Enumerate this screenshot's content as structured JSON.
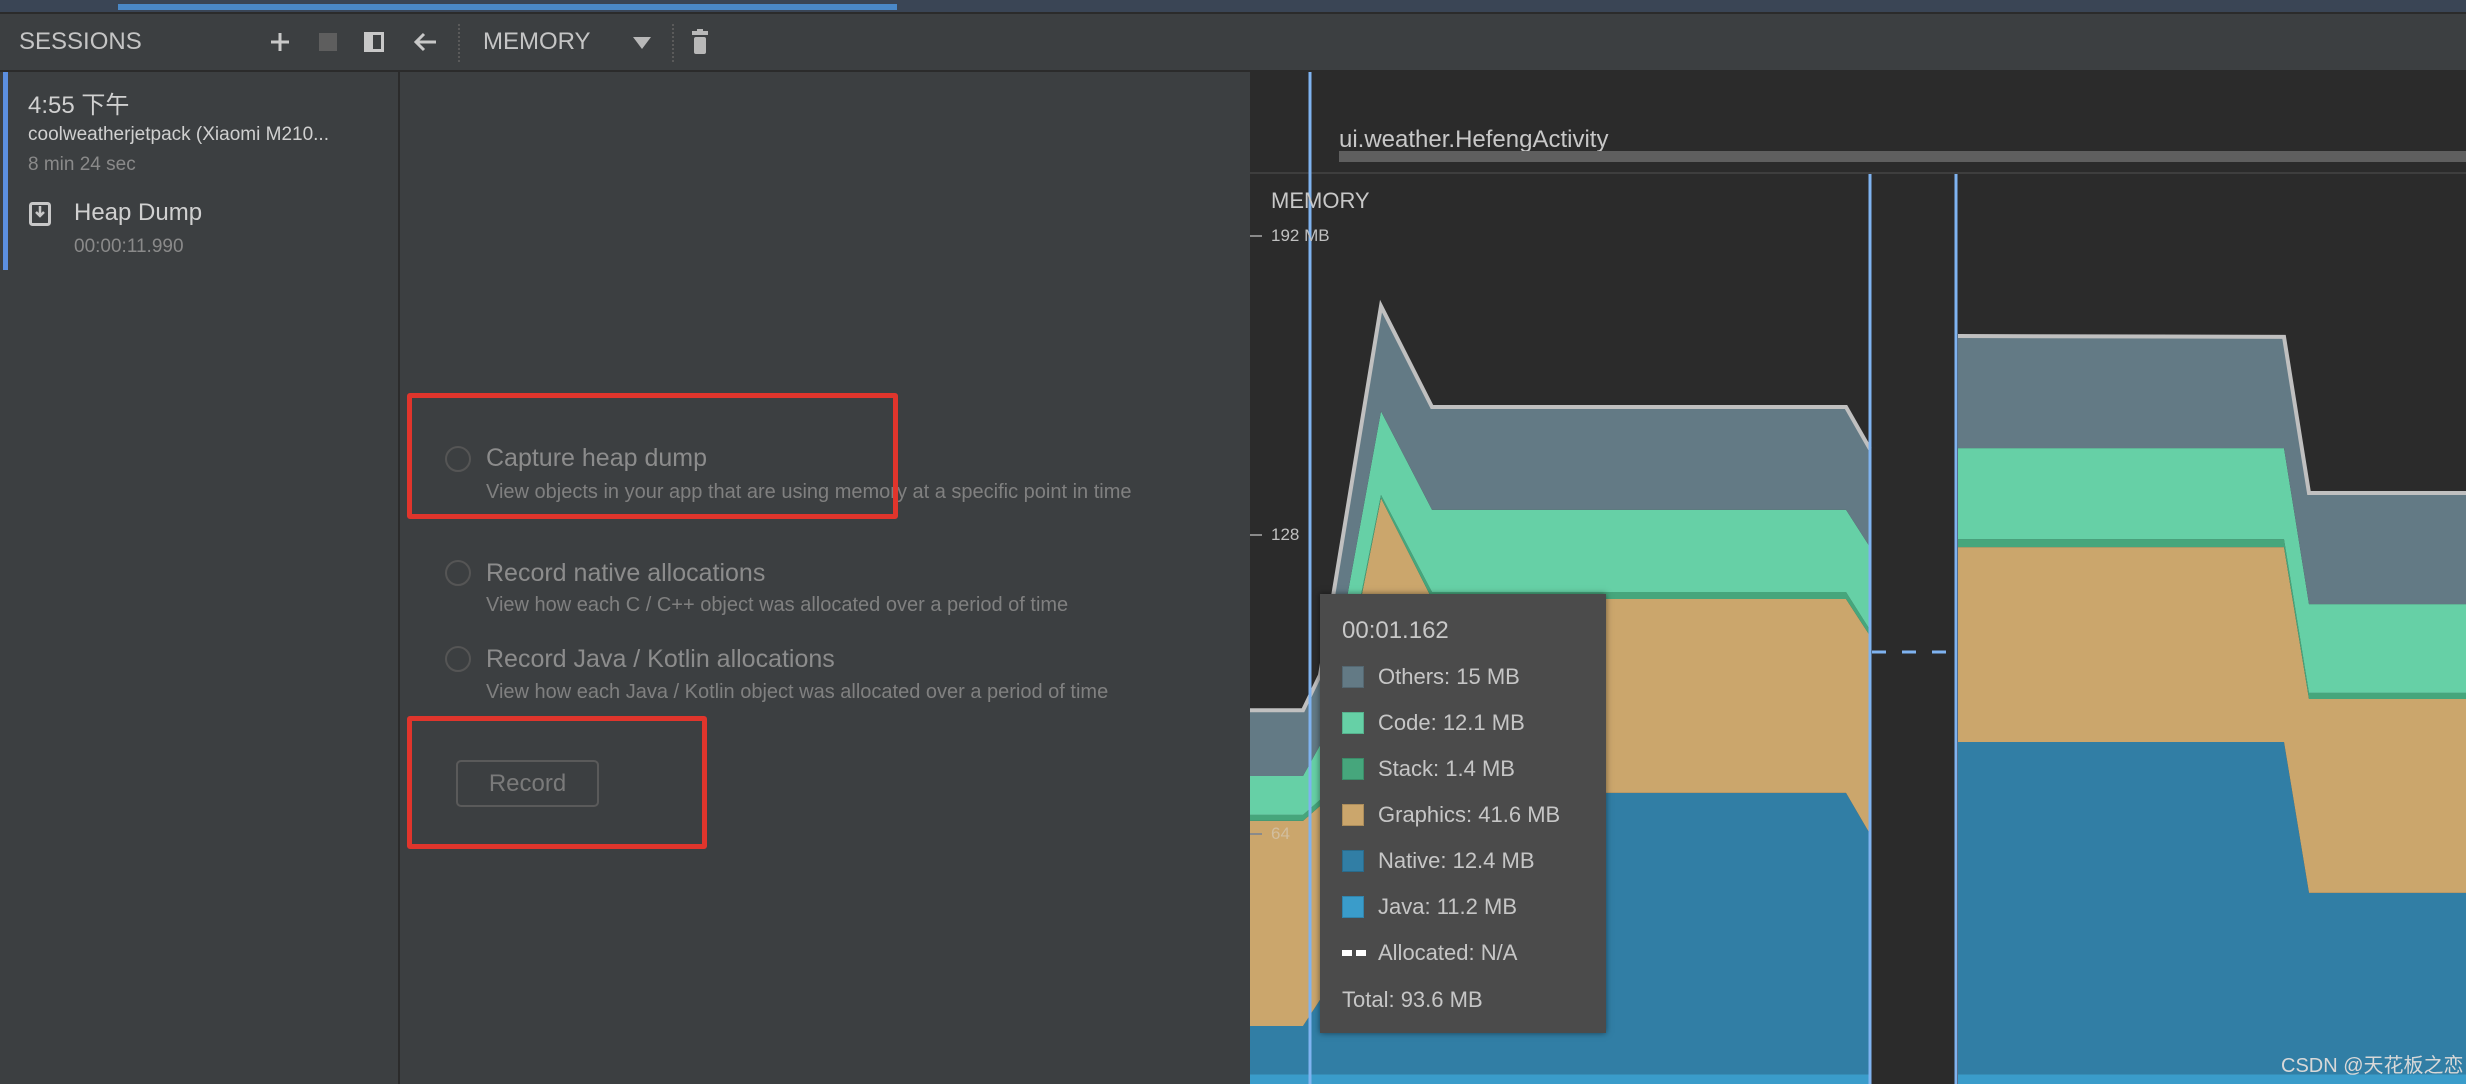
{
  "toolbar": {
    "sessions_title": "SESSIONS",
    "add_icon": "plus-icon",
    "stop_icon": "stop-icon",
    "layout_icon": "panel-toggle-icon",
    "back_icon": "arrow-left-icon",
    "profiler_select": "MEMORY",
    "delete_icon": "trash-icon"
  },
  "session": {
    "time": "4:55 下午",
    "app": "coolweatherjetpack (Xiaomi M210...",
    "duration": "8 min 24 sec",
    "artifact": {
      "icon": "heap-dump-icon",
      "title": "Heap Dump",
      "timestamp": "00:00:11.990"
    }
  },
  "options": [
    {
      "title": "Capture heap dump",
      "desc": "View objects in your app that are using memory at a specific point in time",
      "selected": false
    },
    {
      "title": "Record native allocations",
      "desc": "View how each C / C++ object was allocated over a period of time",
      "selected": false
    },
    {
      "title": "Record Java / Kotlin allocations",
      "desc": "View how each Java / Kotlin object was allocated over a period of time",
      "selected": false
    }
  ],
  "record_label": "Record",
  "annotation_color": "#e0352c",
  "activity_label": "ui.weather.HefengActivity",
  "chart_data": {
    "type": "area",
    "stacked": true,
    "title": "MEMORY",
    "y_ticks": [
      "192 MB",
      "128",
      "64"
    ],
    "y_tick_values": [
      192,
      128,
      64
    ],
    "ylim": [
      0,
      192
    ],
    "segments": [
      {
        "samples": 7,
        "series": [
          {
            "name": "Java",
            "color": "#3a9cca",
            "values": [
              12.6,
              12.6,
              12.6,
              12.6,
              12.6,
              12.6,
              12.6
            ]
          },
          {
            "name": "Native",
            "color": "#317ea5",
            "values": [
              10.3,
              10.3,
              15.9,
              60.2,
              60.2,
              60.2,
              51.4
            ]
          },
          {
            "name": "Graphics",
            "color": "#cba66c",
            "values": [
              43.9,
              43.9,
              41.5,
              63.1,
              41.5,
              41.5,
              42.4
            ]
          },
          {
            "name": "Stack",
            "color": "#46a67c",
            "values": [
              1.3,
              1.3,
              1.3,
              0.7,
              1.5,
              1.5,
              1.3
            ]
          },
          {
            "name": "Code",
            "color": "#66d0a6",
            "values": [
              8.3,
              8.3,
              11.7,
              17.9,
              17.6,
              17.6,
              17.7
            ]
          },
          {
            "name": "Others",
            "color": "#637a85",
            "values": [
              14.1,
              14.1,
              15.0,
              22.5,
              22.0,
              22.0,
              21.0
            ]
          }
        ]
      },
      {
        "samples": 4,
        "series": [
          {
            "name": "Java",
            "color": "#3a9cca",
            "values": [
              12.6,
              12.6,
              12.6,
              12.6
            ]
          },
          {
            "name": "Native",
            "color": "#317ea5",
            "values": [
              71.1,
              71.1,
              38.8,
              38.8
            ]
          },
          {
            "name": "Graphics",
            "color": "#cba66c",
            "values": [
              41.7,
              41.7,
              41.5,
              41.5
            ]
          },
          {
            "name": "Stack",
            "color": "#46a67c",
            "values": [
              1.7,
              1.7,
              1.3,
              1.3
            ]
          },
          {
            "name": "Code",
            "color": "#66d0a6",
            "values": [
              19.5,
              19.5,
              19.0,
              19.0
            ]
          },
          {
            "name": "Others",
            "color": "#637a85",
            "values": [
              24.0,
              23.8,
              23.8,
              23.8
            ]
          }
        ]
      }
    ],
    "total_line_color": "#c0c0c0",
    "selection_color": "#7fb3f0",
    "grid": false
  },
  "tooltip": {
    "time": "00:01.162",
    "rows": [
      {
        "label": "Others: 15 MB",
        "color": "#637a85"
      },
      {
        "label": "Code: 12.1 MB",
        "color": "#66d0a6"
      },
      {
        "label": "Stack: 1.4 MB",
        "color": "#46a67c"
      },
      {
        "label": "Graphics: 41.6 MB",
        "color": "#cba66c"
      },
      {
        "label": "Native: 12.4 MB",
        "color": "#317ea5"
      },
      {
        "label": "Java: 11.2 MB",
        "color": "#3a9cca"
      }
    ],
    "allocated": "Allocated: N/A",
    "total": "Total: 93.6 MB"
  },
  "watermark": "CSDN @天花板之恋"
}
